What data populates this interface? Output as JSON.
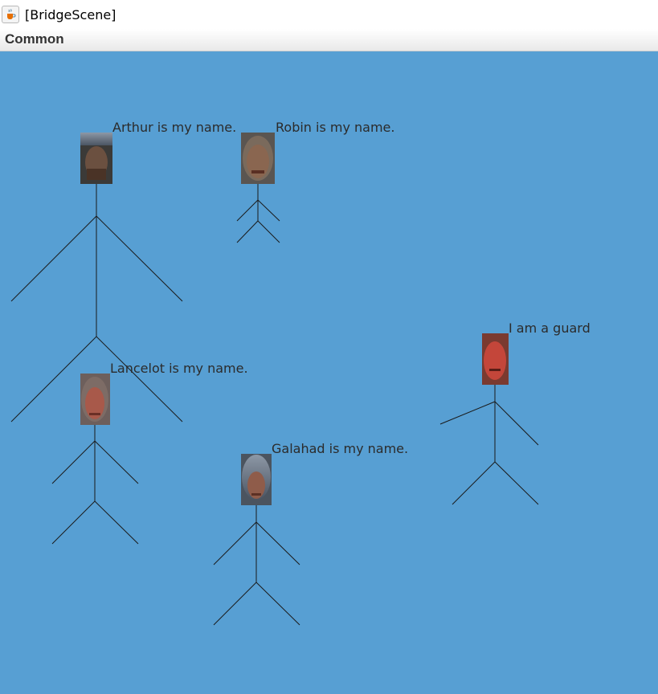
{
  "window": {
    "title": "[BridgeScene]",
    "app_icon": "java-coffee-cup-icon"
  },
  "menubar": {
    "items": [
      "Common"
    ]
  },
  "scene": {
    "background_color": "#579fd3",
    "line_color": "#1a1a1a",
    "characters": [
      {
        "id": "arthur",
        "speech": "Arthur is my name.",
        "face": "arthur-face-icon",
        "skin": "#6b5040"
      },
      {
        "id": "robin",
        "speech": "Robin is my name.",
        "face": "robin-face-icon",
        "skin": "#8a6650"
      },
      {
        "id": "lancelot",
        "speech": "Lancelot is my name.",
        "face": "lancelot-face-icon",
        "skin": "#a8594a"
      },
      {
        "id": "galahad",
        "speech": "Galahad is my name.",
        "face": "galahad-face-icon",
        "skin": "#8f5c4a"
      },
      {
        "id": "guard",
        "speech": "I am a guard",
        "face": "guard-face-icon",
        "skin": "#c4463a"
      }
    ]
  }
}
